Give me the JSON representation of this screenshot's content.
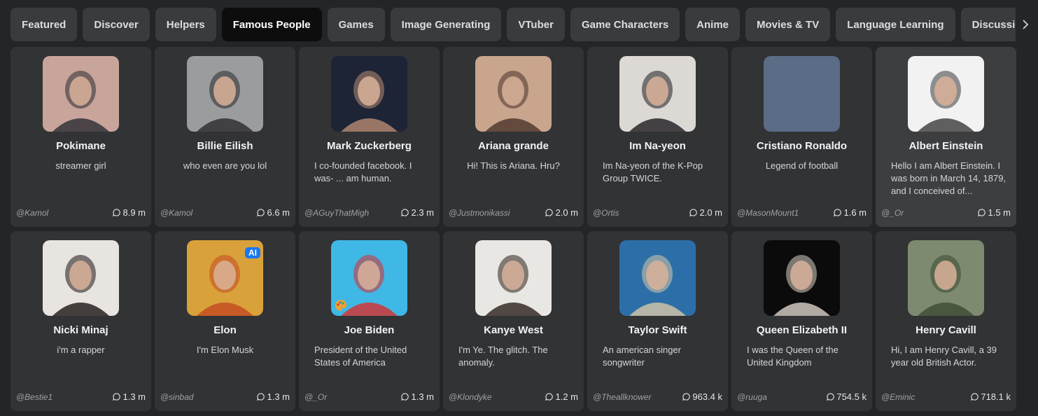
{
  "tabs": [
    {
      "label": "Featured",
      "active": false
    },
    {
      "label": "Discover",
      "active": false
    },
    {
      "label": "Helpers",
      "active": false
    },
    {
      "label": "Famous People",
      "active": true
    },
    {
      "label": "Games",
      "active": false
    },
    {
      "label": "Image Generating",
      "active": false
    },
    {
      "label": "VTuber",
      "active": false
    },
    {
      "label": "Game Characters",
      "active": false
    },
    {
      "label": "Anime",
      "active": false
    },
    {
      "label": "Movies & TV",
      "active": false
    },
    {
      "label": "Language Learning",
      "active": false
    },
    {
      "label": "Discussion",
      "active": false
    }
  ],
  "tabs_next_icon": "chevron-right-icon",
  "characters": [
    {
      "name": "Pokimane",
      "description": "streamer girl",
      "author": "@Kamol",
      "interactions": "8.9 m",
      "center": true,
      "avatar_color": "#c8a49a",
      "avatar_accent": "#2b2c33"
    },
    {
      "name": "Billie Eilish",
      "description": "who even are you lol",
      "author": "@Kamol",
      "interactions": "6.6 m",
      "center": true,
      "avatar_color": "#9a9c9e",
      "avatar_accent": "#2a2a2c"
    },
    {
      "name": "Mark Zuckerberg",
      "description": "I co-founded facebook. I was- ... am human.",
      "author": "@AGuyThatMigh",
      "interactions": "2.3 m",
      "center": false,
      "avatar_color": "#1c2436",
      "avatar_accent": "#b88a72"
    },
    {
      "name": "Ariana grande",
      "description": "Hi! This is Ariana. Hru?",
      "author": "@Justmonikassi",
      "interactions": "2.0 m",
      "center": true,
      "avatar_color": "#c9a58e",
      "avatar_accent": "#4a3329"
    },
    {
      "name": "Im Na-yeon",
      "description": "Im Na-yeon of the K-Pop Group TWICE.",
      "author": "@Ortis",
      "interactions": "2.0 m",
      "center": false,
      "avatar_color": "#dcd8d4",
      "avatar_accent": "#1d1b1e"
    },
    {
      "name": "Cristiano Ronaldo",
      "description": "Legend of football",
      "author": "@MasonMount1",
      "interactions": "1.6 m",
      "center": true,
      "avatar_color": "#5a6c86",
      "avatar_accent": "#5a6c86"
    },
    {
      "name": "Albert Einstein",
      "description": "Hello I am Albert Einstein. I was born in March 14, 1879, and I conceived of...",
      "author": "@_Or",
      "interactions": "1.5 m",
      "center": false,
      "avatar_color": "#f2f2f2",
      "avatar_accent": "#3a3a3a"
    },
    {
      "name": "Nicki Minaj",
      "description": "i'm a rapper",
      "author": "@Bestie1",
      "interactions": "1.3 m",
      "center": true,
      "avatar_color": "#e8e4e0",
      "avatar_accent": "#1a1414"
    },
    {
      "name": "Elon",
      "description": "I'm Elon Musk",
      "author": "@sinbad",
      "interactions": "1.3 m",
      "center": true,
      "avatar_color": "#d9a13a",
      "avatar_accent": "#c24a22",
      "badge": "AI"
    },
    {
      "name": "Joe Biden",
      "description": "President of the United States of America",
      "author": "@_Or",
      "interactions": "1.3 m",
      "center": false,
      "avatar_color": "#3fb8e6",
      "avatar_accent": "#d92d2d",
      "palette": true
    },
    {
      "name": "Kanye West",
      "description": "I'm Ye. The glitch. The anomaly.",
      "author": "@Klondyke",
      "interactions": "1.2 m",
      "center": false,
      "avatar_color": "#e9e7e3",
      "avatar_accent": "#2a1f1a"
    },
    {
      "name": "Taylor Swift",
      "description": "An american singer songwriter",
      "author": "@Theallknower",
      "interactions": "963.4 k",
      "center": false,
      "avatar_color": "#2c6fa8",
      "avatar_accent": "#d8c8a8"
    },
    {
      "name": "Queen Elizabeth II",
      "description": "I was the Queen of the United Kingdom",
      "author": "@ruuga",
      "interactions": "754.5 k",
      "center": false,
      "avatar_color": "#0b0b0b",
      "avatar_accent": "#d9d2c8"
    },
    {
      "name": "Henry Cavill",
      "description": "Hi, I am Henry Cavill, a 39 year old British Actor.",
      "author": "@Eminic",
      "interactions": "718.1 k",
      "center": false,
      "avatar_color": "#7d8a70",
      "avatar_accent": "#3b4a32"
    }
  ],
  "highlight_index": 6,
  "colors": {
    "background": "#242526",
    "card": "#323335",
    "tab": "#3a3b3c",
    "tab_active": "#0d0d0d"
  }
}
